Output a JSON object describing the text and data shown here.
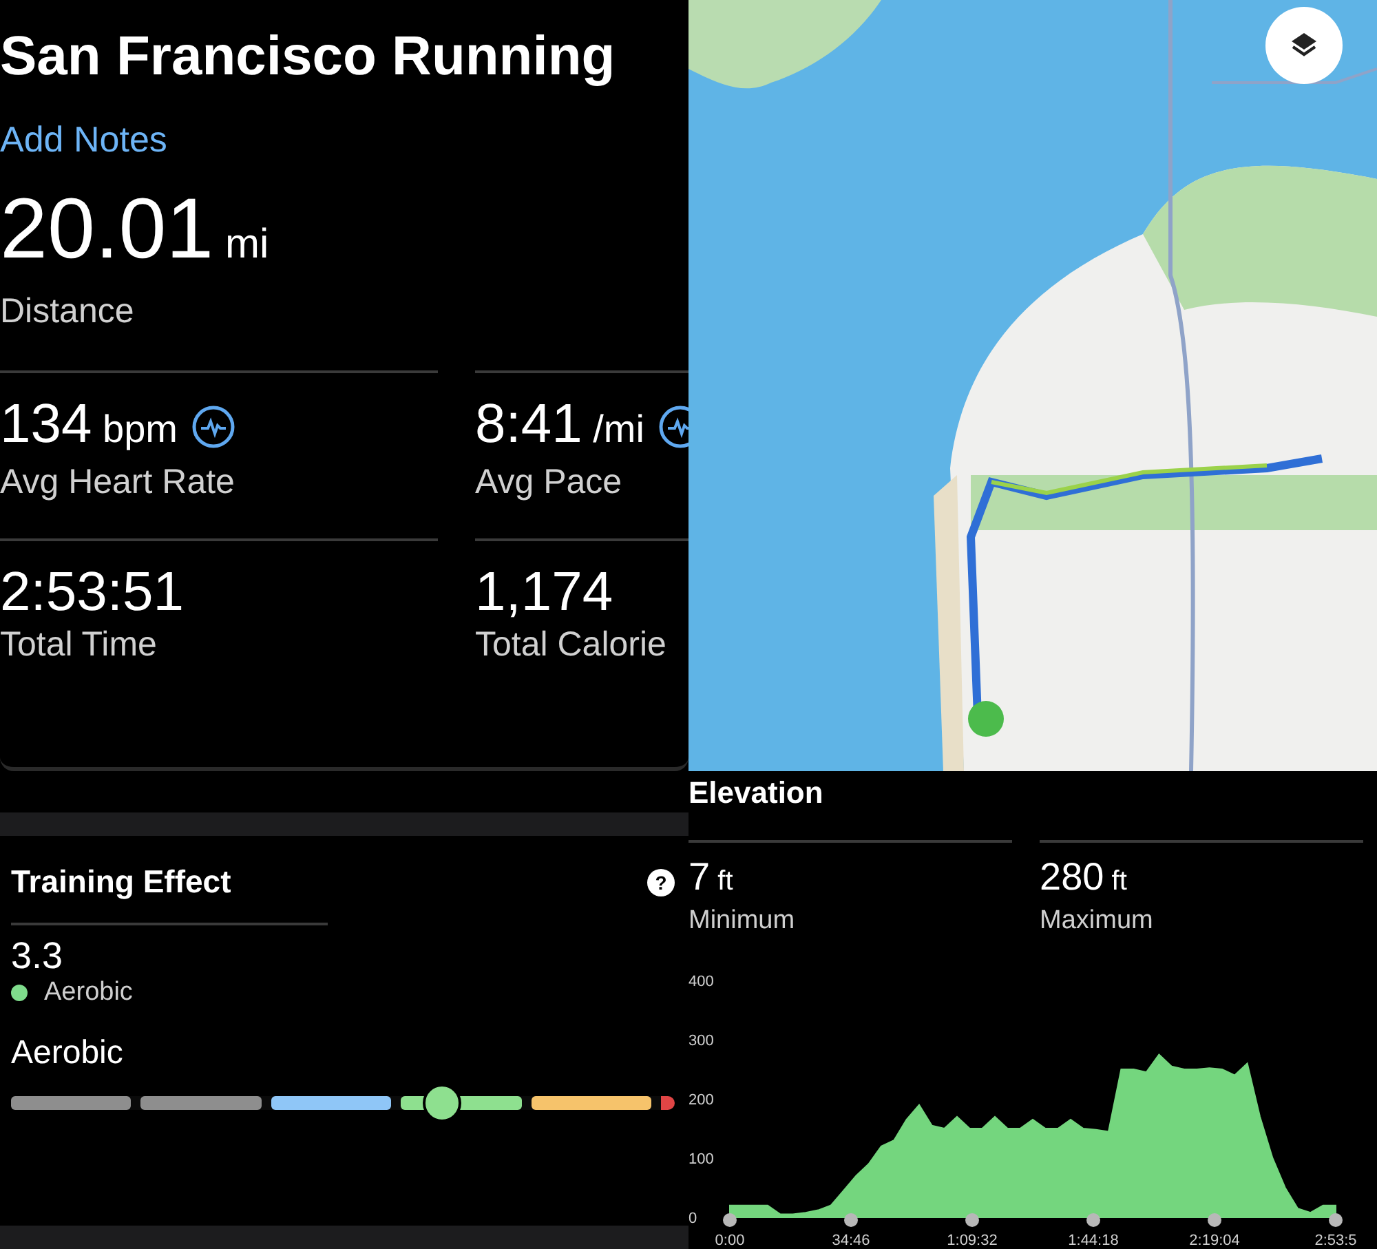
{
  "activity": {
    "title": "San Francisco Running",
    "add_notes": "Add Notes",
    "distance": {
      "value": "20.01",
      "unit": "mi",
      "label": "Distance"
    }
  },
  "stats": [
    {
      "value": "134",
      "unit": "bpm",
      "label": "Avg Heart Rate",
      "icon": true
    },
    {
      "value": "8:41",
      "unit": "/mi",
      "label": "Avg Pace",
      "icon": true
    },
    {
      "value": "2:53:51",
      "label": "Total Time",
      "icon": false
    },
    {
      "value": "1,174",
      "label": "Total Calorie",
      "icon": false
    }
  ],
  "training_effect": {
    "title": "Training Effect",
    "help": "?",
    "value": "3.3",
    "legend": {
      "label": "Aerobic",
      "color": "#7fdc8c"
    },
    "gauge_label": "Aerobic",
    "level": 0.65,
    "segments": [
      {
        "color": "#8e8e8e"
      },
      {
        "color": "#8e8e8e"
      },
      {
        "color": "#8fc6f7"
      },
      {
        "color": "#8ee08f"
      },
      {
        "color": "#f6c36b"
      },
      {
        "color": "#e04545"
      }
    ]
  },
  "elevation": {
    "minimum": {
      "value": "7",
      "unit": "ft",
      "label": "Minimum"
    },
    "maximum": {
      "value": "280",
      "unit": "ft",
      "label": "Maximum"
    },
    "chart_data": {
      "type": "area",
      "ylim": [
        0,
        400
      ],
      "yticks": [
        0,
        100,
        200,
        300,
        400
      ],
      "xlim": [
        0,
        173.83
      ],
      "xticks": [
        {
          "value": 0,
          "label": "0:00"
        },
        {
          "value": 34.77,
          "label": "34:46"
        },
        {
          "value": 69.53,
          "label": "1:09:32"
        },
        {
          "value": 104.3,
          "label": "1:44:18"
        },
        {
          "value": 139.07,
          "label": "2:19:04"
        },
        {
          "value": 173.83,
          "label": "2:53:5"
        }
      ],
      "x": [
        0,
        3.62,
        7.24,
        10.86,
        14.49,
        18.11,
        21.73,
        25.35,
        28.97,
        32.59,
        36.22,
        39.84,
        43.46,
        47.08,
        50.7,
        54.32,
        57.94,
        61.57,
        65.19,
        68.81,
        72.43,
        76.05,
        79.67,
        83.29,
        86.92,
        90.54,
        94.16,
        97.78,
        101.4,
        105.02,
        108.65,
        112.27,
        115.89,
        119.51,
        123.13,
        126.75,
        130.37,
        134,
        137.62,
        141.24,
        144.86,
        148.48,
        152.1,
        155.72,
        159.35,
        162.97,
        166.59,
        170.21,
        173.83
      ],
      "series": [
        {
          "name": "Elevation",
          "color": "#74d67e",
          "values": [
            20,
            20,
            20,
            20,
            5,
            5,
            8,
            12,
            20,
            45,
            70,
            90,
            120,
            130,
            165,
            190,
            155,
            150,
            170,
            150,
            150,
            170,
            150,
            150,
            165,
            150,
            150,
            165,
            150,
            148,
            145,
            250,
            250,
            245,
            275,
            255,
            250,
            250,
            252,
            250,
            240,
            260,
            170,
            100,
            50,
            15,
            8,
            20,
            20
          ]
        }
      ]
    }
  }
}
